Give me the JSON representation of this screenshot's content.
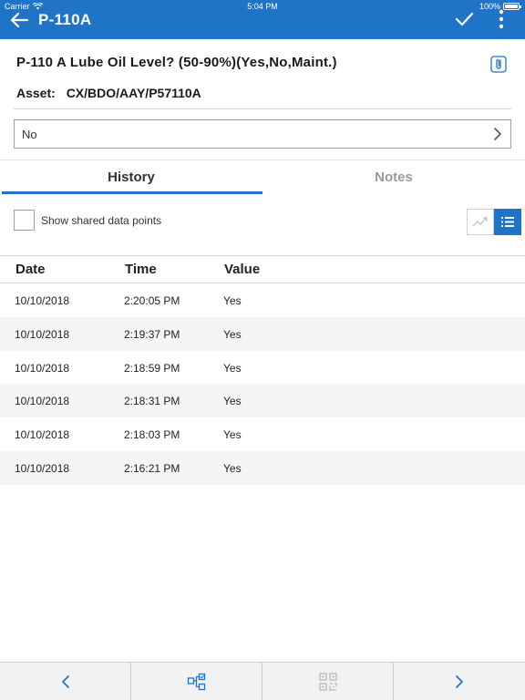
{
  "status_bar": {
    "carrier": "Carrier",
    "time": "5:04 PM",
    "battery": "100%",
    "battery_level": 1.0
  },
  "nav": {
    "title": "P-110A",
    "back_icon": "arrow-left-icon",
    "confirm_icon": "checkmark-icon",
    "more_icon": "more-vertical-icon"
  },
  "question": {
    "text": "P-110 A Lube Oil Level? (50-90%)(Yes,No,Maint.)",
    "attach_icon": "paperclip-icon"
  },
  "asset": {
    "label": "Asset:",
    "value": "CX/BDO/AAY/P57110A"
  },
  "answer": {
    "value": "No"
  },
  "tabs": [
    {
      "label": "History",
      "active": true
    },
    {
      "label": "Notes",
      "active": false
    }
  ],
  "shared_toggle": {
    "label": "Show shared data points",
    "checked": false
  },
  "view_toggle": {
    "chart_icon": "trend-chart-icon",
    "list_icon": "list-icon",
    "active": "list"
  },
  "table": {
    "headers": [
      "Date",
      "Time",
      "Value"
    ],
    "rows": [
      {
        "date": "10/10/2018",
        "time": "2:20:05 PM",
        "value": "Yes"
      },
      {
        "date": "10/10/2018",
        "time": "2:19:37 PM",
        "value": "Yes"
      },
      {
        "date": "10/10/2018",
        "time": "2:18:59 PM",
        "value": "Yes"
      },
      {
        "date": "10/10/2018",
        "time": "2:18:31 PM",
        "value": "Yes"
      },
      {
        "date": "10/10/2018",
        "time": "2:18:03 PM",
        "value": "Yes"
      },
      {
        "date": "10/10/2018",
        "time": "2:16:21 PM",
        "value": "Yes"
      }
    ]
  },
  "footer": {
    "icons": [
      "chevron-left-icon",
      "hierarchy-icon",
      "qr-scan-icon",
      "chevron-right-icon"
    ]
  },
  "colors": {
    "accent": "#1f74c8",
    "disabled": "#b9b9b9"
  }
}
